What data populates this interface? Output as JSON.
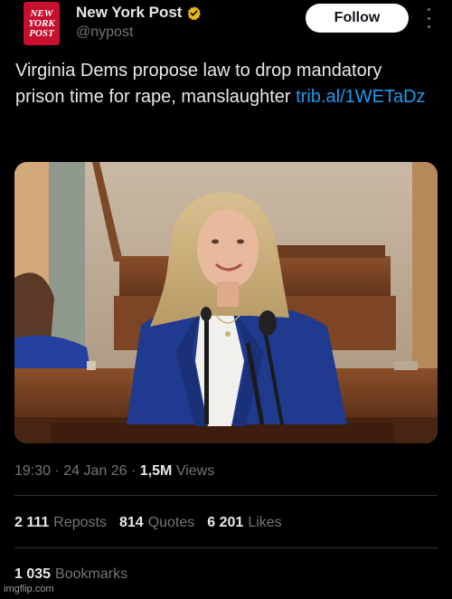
{
  "account": {
    "name": "New York Post",
    "handle": "@nypost",
    "verified_icon": "verified-badge-icon",
    "avatar_lines": [
      "NEW",
      "YORK",
      "POST"
    ],
    "brand_color": "#c8102e"
  },
  "actions": {
    "follow_label": "Follow",
    "more_icon": "more-options-icon"
  },
  "tweet": {
    "text": "Virginia Dems propose law to drop mandatory prison time for rape, manslaughter ",
    "link": "trib.al/1WETaDz"
  },
  "meta": {
    "time": "19:30",
    "sep1": "·",
    "date": "24 Jan 26",
    "sep2": "·",
    "views_count": "1,5M",
    "views_label": "Views"
  },
  "stats": {
    "reposts_count": "2 111",
    "reposts_label": "Reposts",
    "quotes_count": "814",
    "quotes_label": "Quotes",
    "likes_count": "6 201",
    "likes_label": "Likes",
    "bookmarks_count": "1 035",
    "bookmarks_label": "Bookmarks"
  },
  "watermark": "imgflip.com",
  "colors": {
    "background": "#000000",
    "link": "#1d9bf0",
    "muted": "#71767b",
    "text": "#e7e9ea"
  }
}
